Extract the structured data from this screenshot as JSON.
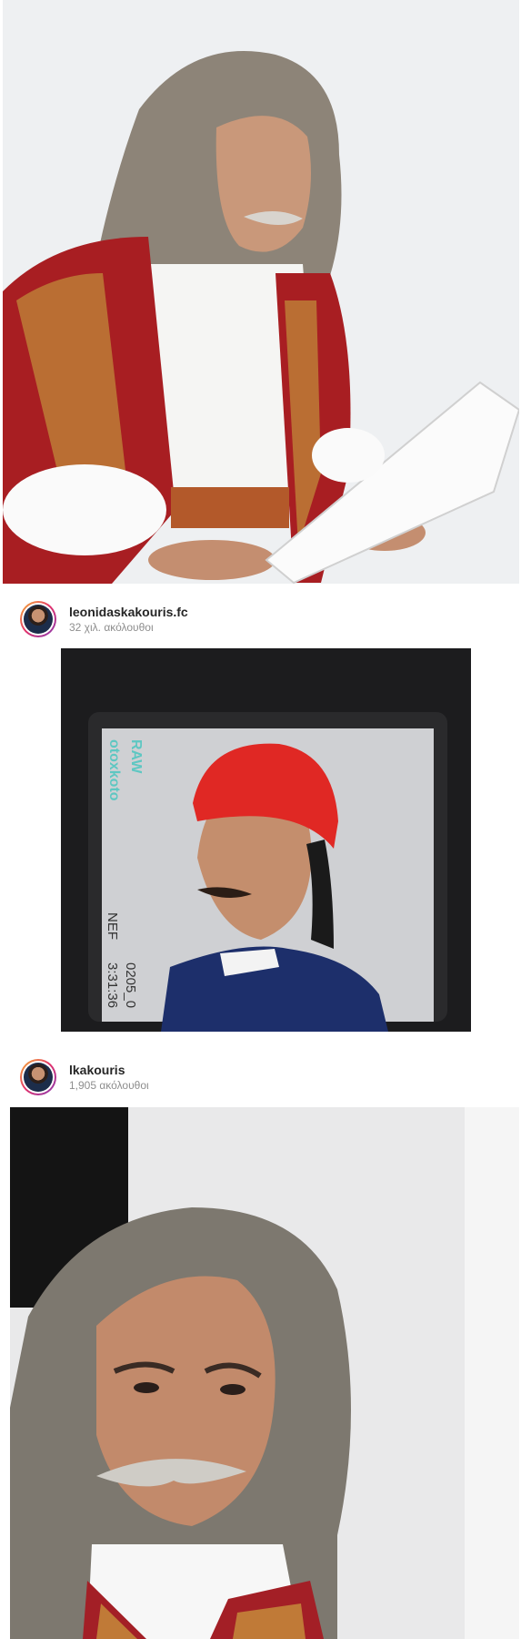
{
  "posts": [
    {
      "photo_icon": "portrait-photo-icon"
    },
    {
      "username": "leonidaskakouris.fc",
      "followers": "32 χιλ. ακόλουθοι",
      "photo_icon": "camera-viewfinder-photo-icon",
      "viewfinder_texts": [
        "RAW",
        "otoxkoto",
        "NEF",
        "3:31:36",
        "0205_0"
      ]
    },
    {
      "username": "lkakouris",
      "followers": "1,905 ακόλουθοι",
      "photo_icon": "selfie-photo-icon"
    }
  ]
}
